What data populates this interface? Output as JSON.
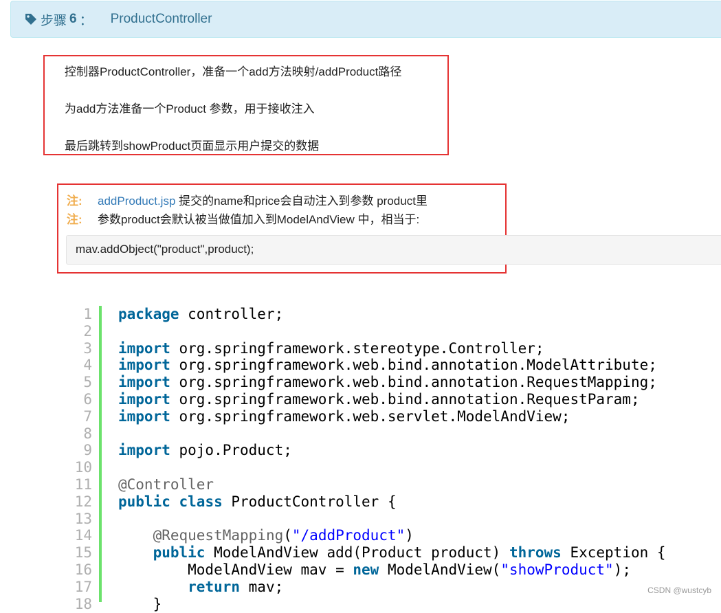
{
  "step": {
    "label": "步骤",
    "number": "6",
    "colon": "：",
    "title": "ProductController"
  },
  "description": {
    "line1": "控制器ProductController，准备一个add方法映射/addProduct路径",
    "line2": "为add方法准备一个Product 参数，用于接收注入",
    "line3": "最后跳转到showProduct页面显示用户提交的数据"
  },
  "notes": [
    {
      "prefix": "注:",
      "link": "addProduct.jsp",
      "text": " 提交的name和price会自动注入到参数 product里"
    },
    {
      "prefix": "注:",
      "link": "",
      "text": "参数product会默认被当做值加入到ModelAndView 中，相当于:"
    }
  ],
  "inline_code": "mav.addObject(\"product\",product);",
  "code_lines": [
    {
      "n": "1",
      "parts": [
        {
          "t": "package",
          "c": "kw"
        },
        {
          "t": " controller;",
          "c": ""
        }
      ]
    },
    {
      "n": "2",
      "parts": []
    },
    {
      "n": "3",
      "parts": [
        {
          "t": "import",
          "c": "kw"
        },
        {
          "t": " org.springframework.stereotype.Controller;",
          "c": ""
        }
      ]
    },
    {
      "n": "4",
      "parts": [
        {
          "t": "import",
          "c": "kw"
        },
        {
          "t": " org.springframework.web.bind.annotation.ModelAttribute;",
          "c": ""
        }
      ]
    },
    {
      "n": "5",
      "parts": [
        {
          "t": "import",
          "c": "kw"
        },
        {
          "t": " org.springframework.web.bind.annotation.RequestMapping;",
          "c": ""
        }
      ]
    },
    {
      "n": "6",
      "parts": [
        {
          "t": "import",
          "c": "kw"
        },
        {
          "t": " org.springframework.web.bind.annotation.RequestParam;",
          "c": ""
        }
      ]
    },
    {
      "n": "7",
      "parts": [
        {
          "t": "import",
          "c": "kw"
        },
        {
          "t": " org.springframework.web.servlet.ModelAndView;",
          "c": ""
        }
      ]
    },
    {
      "n": "8",
      "parts": []
    },
    {
      "n": "9",
      "parts": [
        {
          "t": "import",
          "c": "kw"
        },
        {
          "t": " pojo.Product;",
          "c": ""
        }
      ]
    },
    {
      "n": "10",
      "parts": []
    },
    {
      "n": "11",
      "parts": [
        {
          "t": "@Controller",
          "c": "ann"
        }
      ]
    },
    {
      "n": "12",
      "parts": [
        {
          "t": "public",
          "c": "kw"
        },
        {
          "t": " ",
          "c": ""
        },
        {
          "t": "class",
          "c": "kw"
        },
        {
          "t": " ProductController {",
          "c": ""
        }
      ]
    },
    {
      "n": "13",
      "parts": []
    },
    {
      "n": "14",
      "parts": [
        {
          "t": "    ",
          "c": ""
        },
        {
          "t": "@RequestMapping",
          "c": "ann"
        },
        {
          "t": "(",
          "c": ""
        },
        {
          "t": "\"/addProduct\"",
          "c": "str"
        },
        {
          "t": ")",
          "c": ""
        }
      ]
    },
    {
      "n": "15",
      "parts": [
        {
          "t": "    ",
          "c": ""
        },
        {
          "t": "public",
          "c": "kw"
        },
        {
          "t": " ModelAndView add(Product product) ",
          "c": ""
        },
        {
          "t": "throws",
          "c": "kw"
        },
        {
          "t": " Exception {",
          "c": ""
        }
      ]
    },
    {
      "n": "16",
      "parts": [
        {
          "t": "        ModelAndView mav = ",
          "c": ""
        },
        {
          "t": "new",
          "c": "kw"
        },
        {
          "t": " ModelAndView(",
          "c": ""
        },
        {
          "t": "\"showProduct\"",
          "c": "str"
        },
        {
          "t": ");",
          "c": ""
        }
      ]
    },
    {
      "n": "17",
      "parts": [
        {
          "t": "        ",
          "c": ""
        },
        {
          "t": "return",
          "c": "kw"
        },
        {
          "t": " mav;",
          "c": ""
        }
      ]
    },
    {
      "n": "18",
      "parts": [
        {
          "t": "    }",
          "c": ""
        }
      ]
    }
  ],
  "watermark": "CSDN @wustcyb",
  "colors": {
    "step_bg": "#d9edf7",
    "step_text": "#31708f",
    "annotation_box": "#e53333",
    "note_prefix": "#f0ad4e",
    "link": "#337ab7",
    "keyword": "#006699",
    "annotation": "#646464",
    "string": "#0000ff",
    "gutter": "#6ce26c"
  },
  "icons": [
    "tag-icon"
  ]
}
